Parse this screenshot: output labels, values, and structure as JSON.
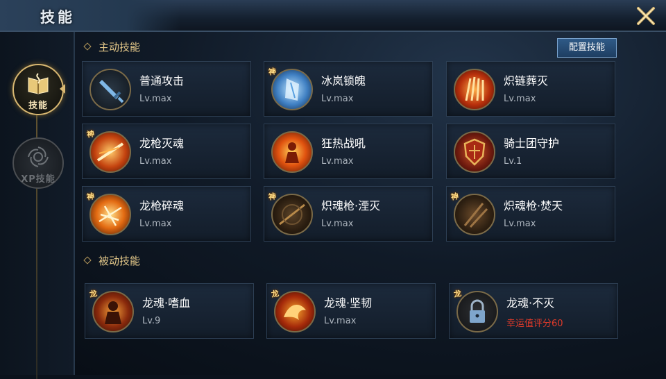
{
  "window": {
    "title": "技能",
    "close_symbol": "✕"
  },
  "sidebar": {
    "tabs": [
      {
        "label": "技能",
        "icon": "skill-book-icon",
        "active": true
      },
      {
        "label": "XP技能",
        "icon": "xp-spiral-icon",
        "active": false
      }
    ]
  },
  "active_skills": {
    "title": "主动技能",
    "config_button": "配置技能",
    "items": [
      {
        "name": "普通攻击",
        "level": "Lv.max",
        "badge": "",
        "icon": "sword-icon"
      },
      {
        "name": "冰岚锁魄",
        "level": "Lv.max",
        "badge": "神",
        "icon": "ice-shard-icon"
      },
      {
        "name": "炽链葬灭",
        "level": "Lv.max",
        "badge": "",
        "icon": "fire-claw-icon"
      },
      {
        "name": "龙枪灭魂",
        "level": "Lv.max",
        "badge": "神",
        "icon": "fire-spear-icon"
      },
      {
        "name": "狂热战吼",
        "level": "Lv.max",
        "badge": "",
        "icon": "war-cry-icon"
      },
      {
        "name": "骑士团守护",
        "level": "Lv.1",
        "badge": "",
        "icon": "shield-icon"
      },
      {
        "name": "龙枪碎魂",
        "level": "Lv.max",
        "badge": "神",
        "icon": "flame-burst-icon"
      },
      {
        "name": "炽魂枪·湮灭",
        "level": "Lv.max",
        "badge": "神",
        "icon": "dark-spear-icon"
      },
      {
        "name": "炽魂枪·焚天",
        "level": "Lv.max",
        "badge": "神",
        "icon": "dark-flame-icon"
      }
    ]
  },
  "passive_skills": {
    "title": "被动技能",
    "items": [
      {
        "name": "龙魂·嗜血",
        "level": "Lv.9",
        "badge": "龙",
        "locked": false,
        "icon": "blood-warrior-icon"
      },
      {
        "name": "龙魂·坚韧",
        "level": "Lv.max",
        "badge": "龙",
        "locked": false,
        "icon": "fire-dragon-icon"
      },
      {
        "name": "龙魂·不灭",
        "level": "幸运值评分60",
        "badge": "龙",
        "locked": true,
        "icon": "lock-icon"
      }
    ]
  },
  "colors": {
    "accent_gold": "#e5c98a",
    "locked_requirement_red": "#e03a2a",
    "config_button_blue": "#2f5a87"
  }
}
